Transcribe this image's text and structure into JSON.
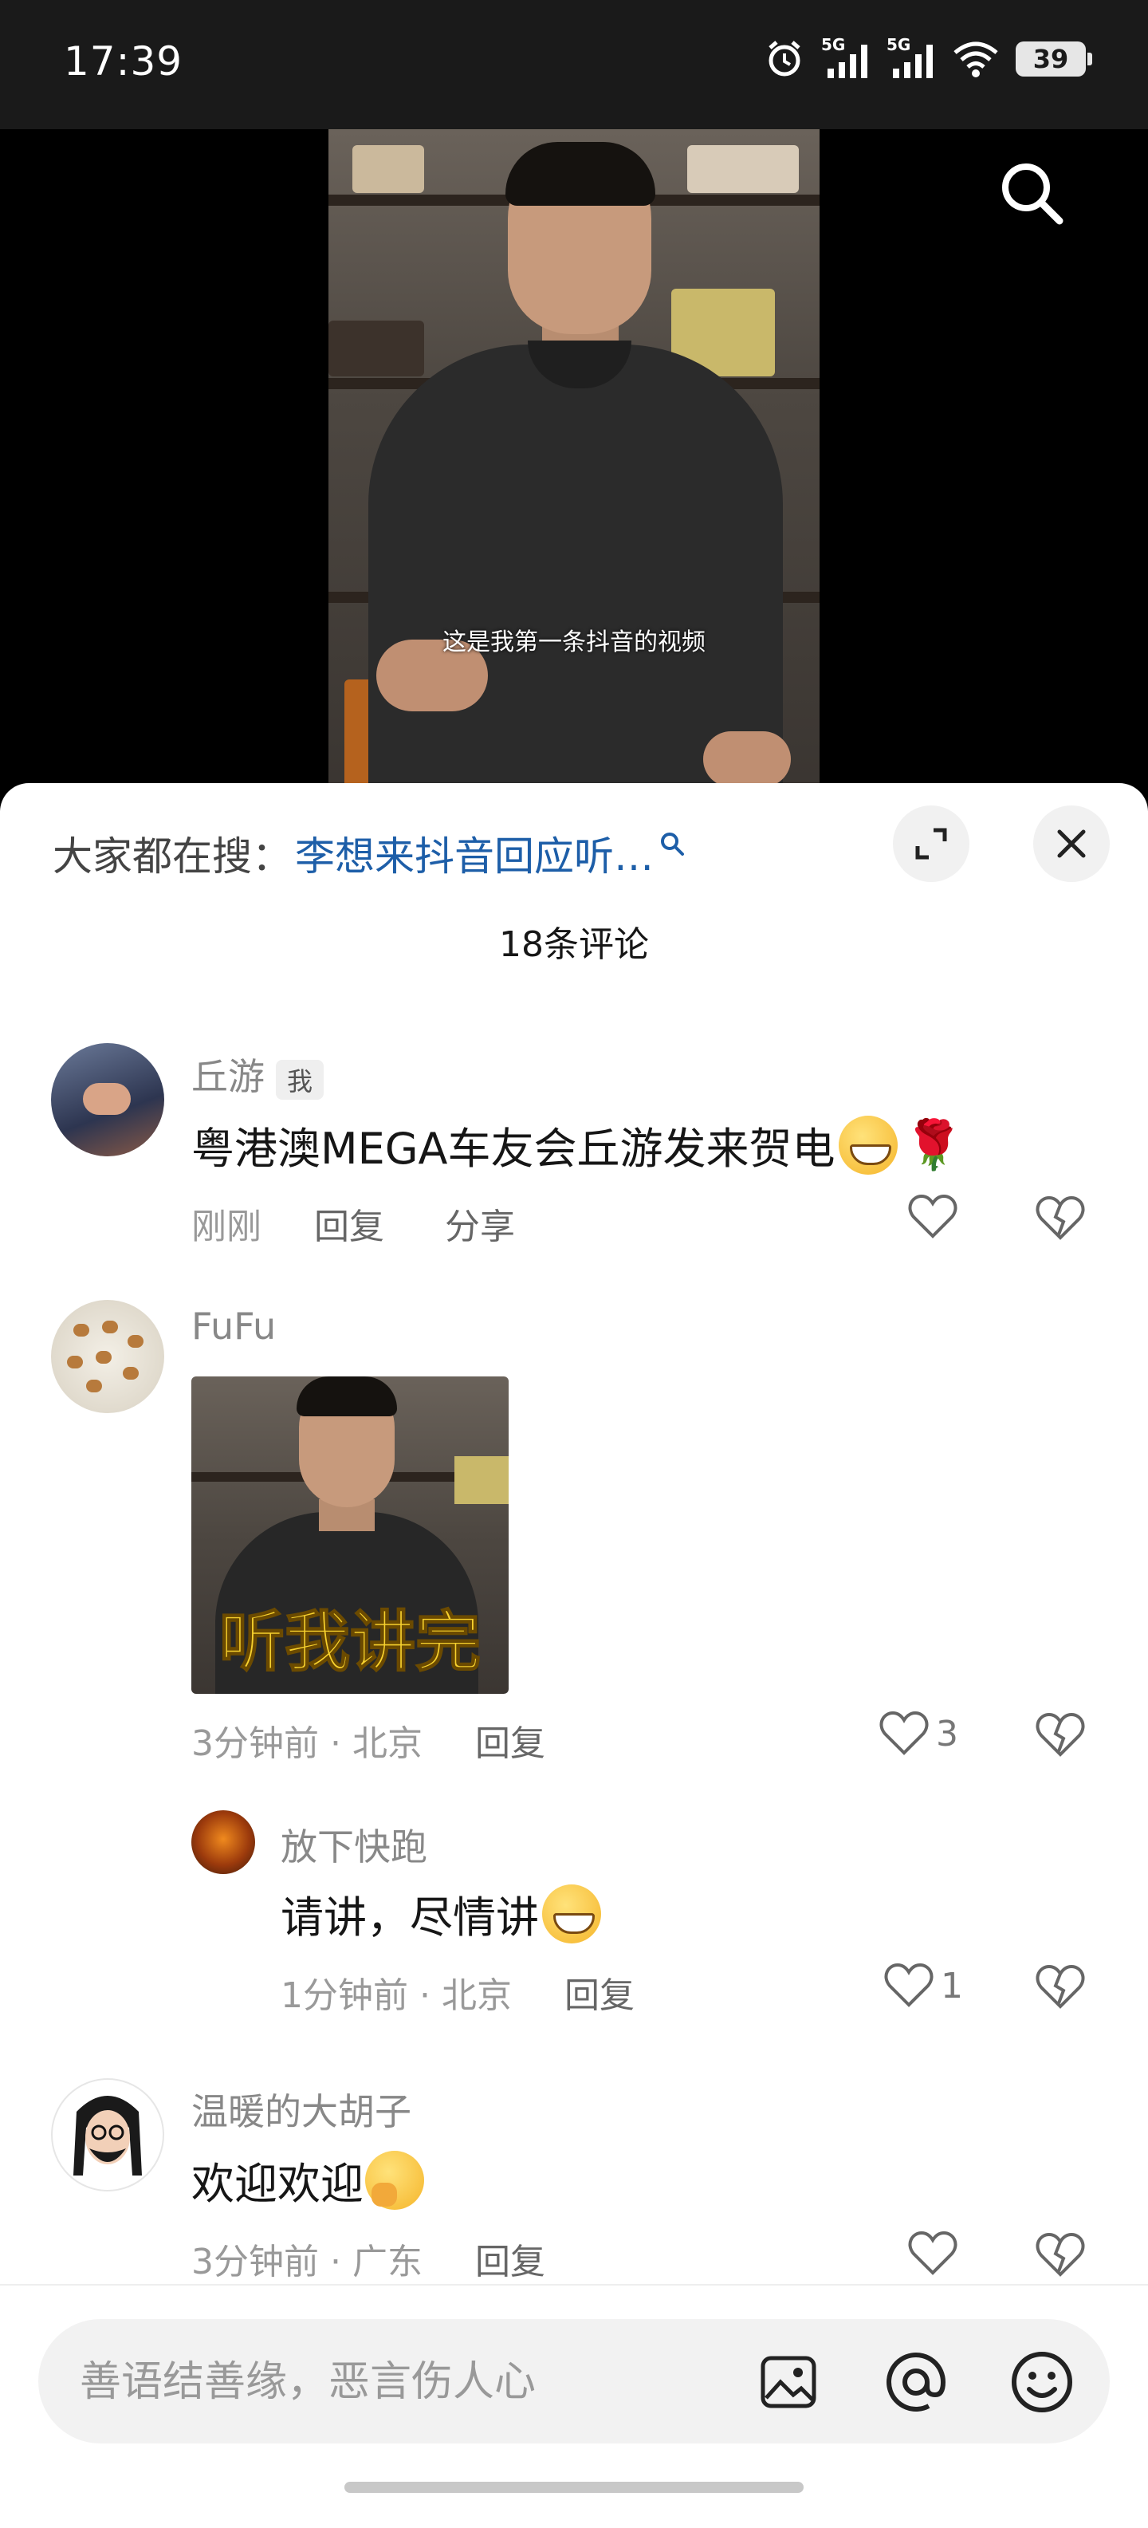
{
  "status_bar": {
    "time": "17:39",
    "network_1": "5G",
    "network_2": "5G",
    "battery": "39"
  },
  "video": {
    "subtitle": "这是我第一条抖音的视频"
  },
  "comments_panel": {
    "trending_label": "大家都在搜：",
    "trending_query": "李想来抖音回应听…",
    "comment_count": "18条评论"
  },
  "comments": [
    {
      "username": "丘游",
      "badge": "我",
      "text": "粤港澳MEGA车友会丘游发来贺电",
      "time": "刚刚",
      "reply_label": "回复",
      "share_label": "分享",
      "likes": ""
    },
    {
      "username": "FuFu",
      "sticker_text": "听我讲完",
      "time": "3分钟前 · 北京",
      "reply_label": "回复",
      "likes": "3"
    },
    {
      "username": "放下快跑",
      "text": "请讲，尽情讲",
      "time": "1分钟前 · 北京",
      "reply_label": "回复",
      "likes": "1"
    },
    {
      "username": "温暖的大胡子",
      "text": "欢迎欢迎",
      "time": "3分钟前 · 广东",
      "reply_label": "回复",
      "likes": ""
    }
  ],
  "input": {
    "placeholder": "善语结善缘，恶言伤人心"
  },
  "icons": {
    "search": "search-icon",
    "expand": "expand-icon",
    "close": "close-icon",
    "like": "heart-outline-icon",
    "dislike": "broken-heart-icon",
    "image": "image-icon",
    "mention": "at-icon",
    "emoji": "smiley-icon"
  },
  "colors": {
    "link": "#1d5ea8",
    "muted_text": "#999999",
    "sticker_text": "#f7d12e"
  }
}
